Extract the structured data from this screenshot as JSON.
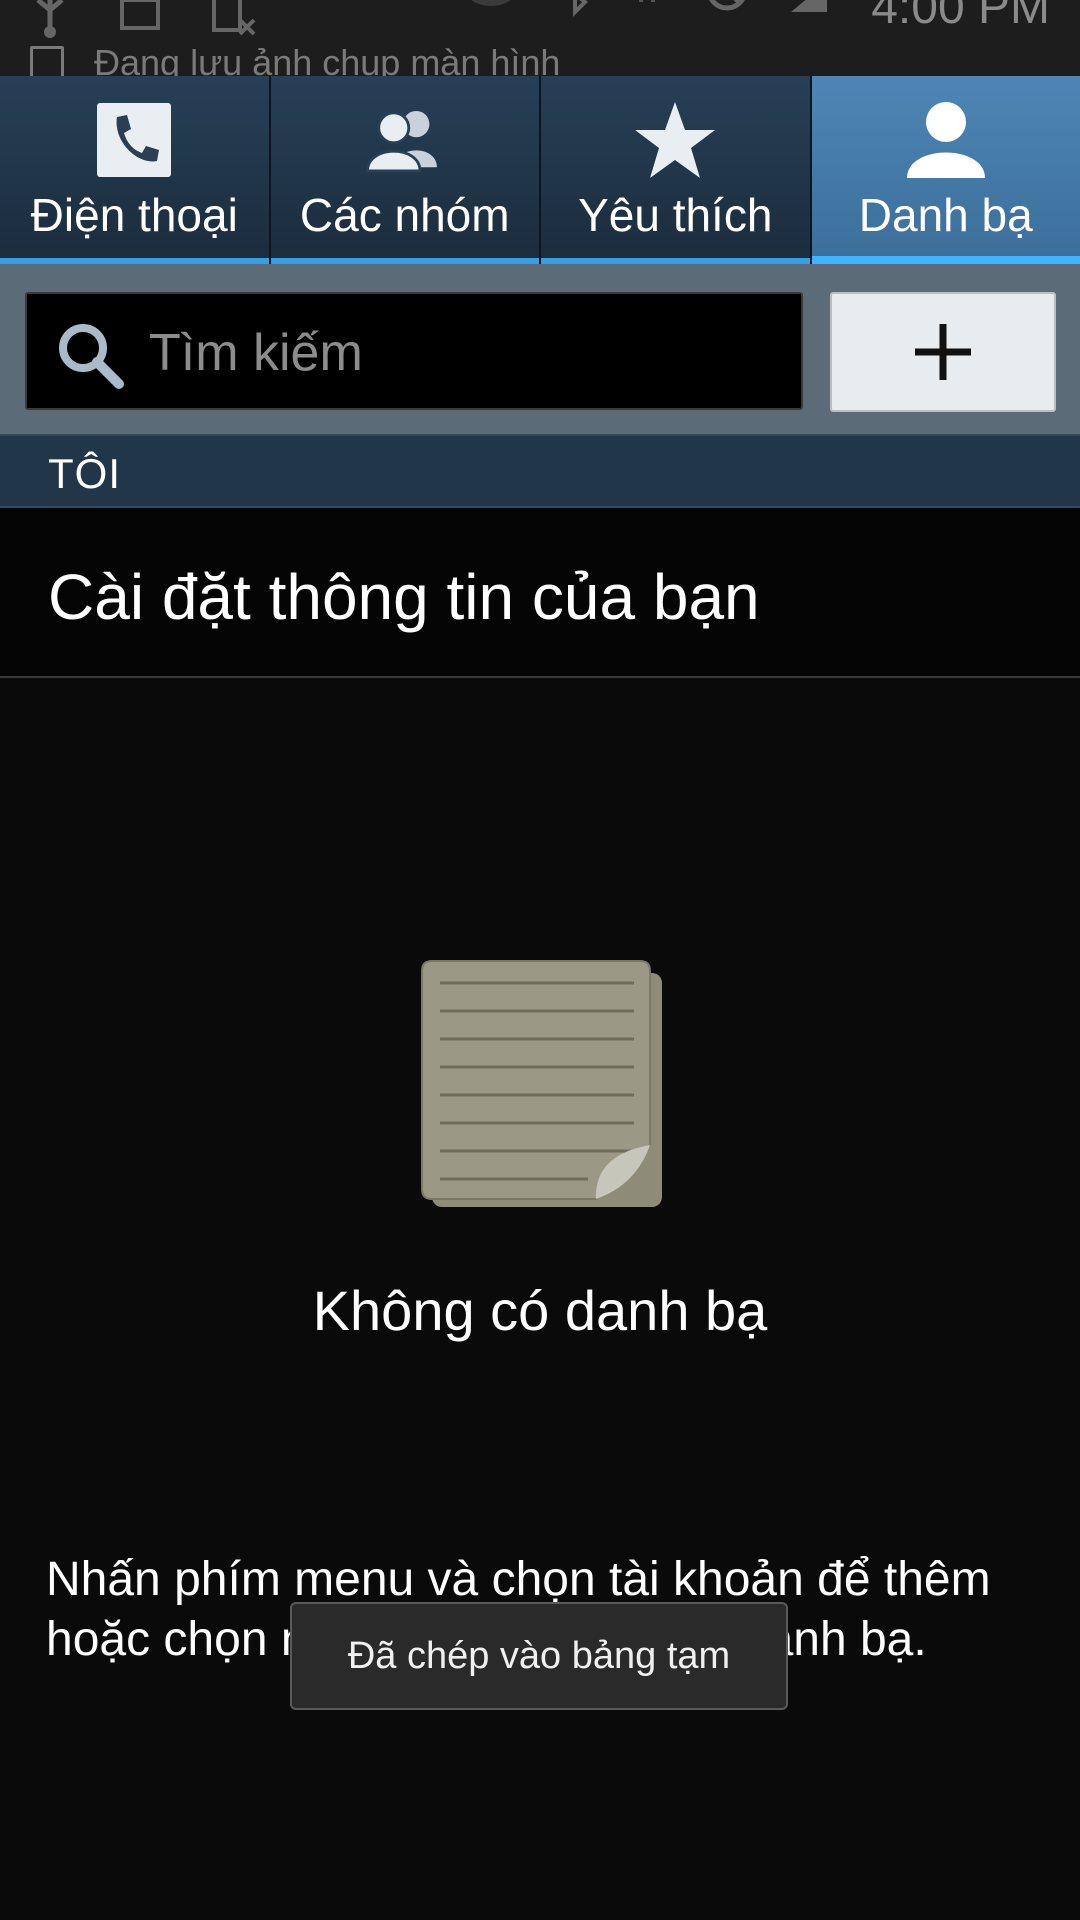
{
  "status_bar": {
    "time": "4:00 PM",
    "notification_text": "Đang lưu ảnh chụp màn hình",
    "icons": [
      "usb-icon",
      "image-icon",
      "no-sim-icon",
      "eye-icon",
      "bluetooth-icon",
      "data-arrows-icon",
      "block-icon",
      "signal-icon"
    ]
  },
  "tabs": [
    {
      "label": "Điện thoại",
      "icon": "phone-icon",
      "active": false
    },
    {
      "label": "Các nhóm",
      "icon": "groups-icon",
      "active": false
    },
    {
      "label": "Yêu thích",
      "icon": "star-icon",
      "active": false
    },
    {
      "label": "Danh bạ",
      "icon": "person-icon",
      "active": true
    }
  ],
  "search": {
    "placeholder": "Tìm kiếm",
    "value": "",
    "add_button": "add-icon"
  },
  "section": {
    "header": "TÔI"
  },
  "profile": {
    "setup_label": "Cài đặt thông tin của bạn"
  },
  "empty_state": {
    "icon": "document-icon",
    "message": "Không có danh bạ",
    "hint": "Nhấn phím menu và chọn tài khoản để thêm hoặc chọn nhập/xuất để chuyển danh bạ."
  },
  "toast": {
    "text": "Đã chép vào bảng tạm"
  },
  "colors": {
    "tab_bg": "#1e2f40",
    "tab_active_bg": "#4d86b5",
    "tab_underline": "#3fb4ff",
    "search_row_bg": "#5b6b78",
    "section_header_bg": "#22364a"
  }
}
